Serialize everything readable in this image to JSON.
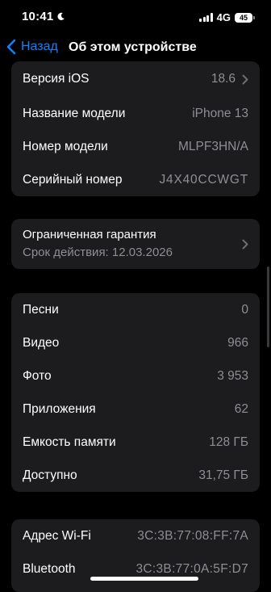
{
  "status_bar": {
    "time": "10:41",
    "network": "4G",
    "battery": "45"
  },
  "nav": {
    "back_label": "Назад",
    "title": "Об этом устройстве"
  },
  "device_info": [
    {
      "label": "Версия iOS",
      "value": "18.6"
    },
    {
      "label": "Название модели",
      "value": "iPhone 13"
    },
    {
      "label": "Номер модели",
      "value": "MLPF3HN/A"
    },
    {
      "label": "Серийный номер",
      "value": "J4X40CCWGT"
    }
  ],
  "warranty": {
    "title": "Ограниченная гарантия",
    "subtitle": "Срок действия: 12.03.2026"
  },
  "storage": [
    {
      "label": "Песни",
      "value": "0"
    },
    {
      "label": "Видео",
      "value": "966"
    },
    {
      "label": "Фото",
      "value": "3 953"
    },
    {
      "label": "Приложения",
      "value": "62"
    },
    {
      "label": "Емкость памяти",
      "value": "128 ГБ"
    },
    {
      "label": "Доступно",
      "value": "31,75 ГБ"
    }
  ],
  "network": [
    {
      "label": "Адрес Wi-Fi",
      "value": "3C:3B:77:08:FF:7A"
    },
    {
      "label": "Bluetooth",
      "value": "3C:3B:77:0A:5F:D7"
    }
  ],
  "colors": {
    "accent": "#0a84ff",
    "background": "#000000",
    "cell": "#1c1c1e",
    "secondary_text": "#8e8e93"
  }
}
